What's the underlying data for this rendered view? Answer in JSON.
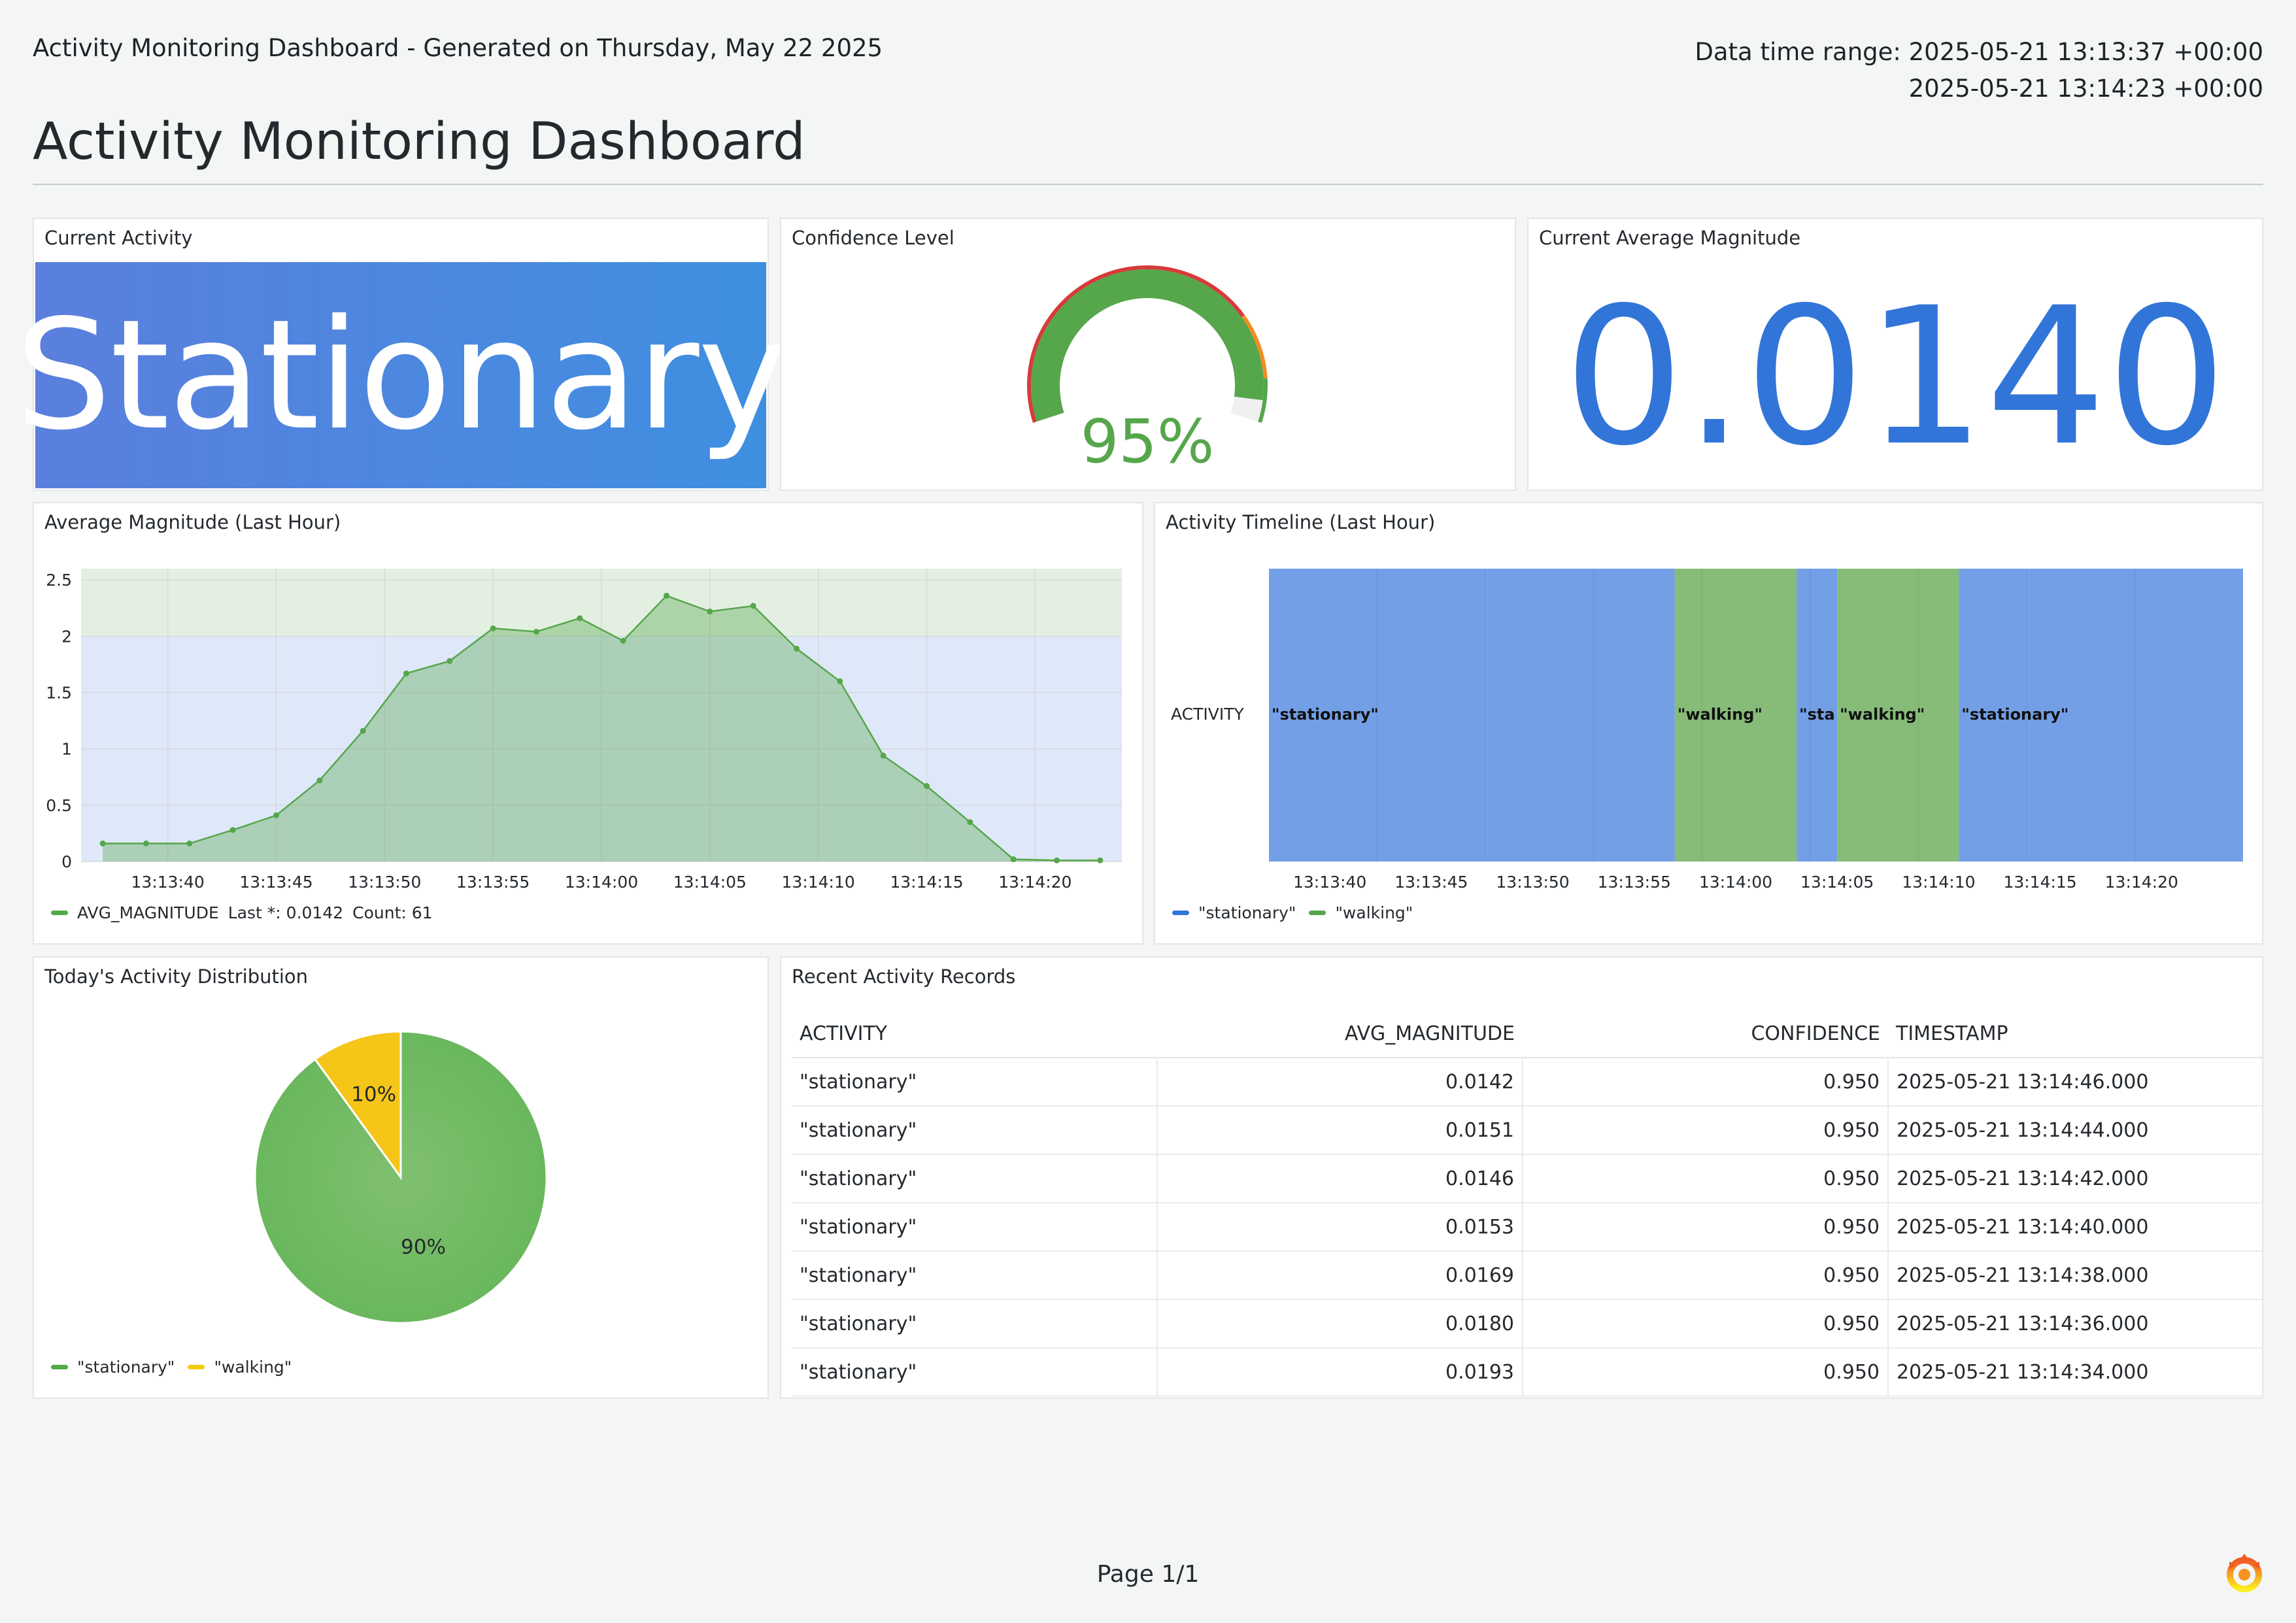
{
  "header": {
    "generated": "Activity Monitoring Dashboard - Generated on Thursday, May 22 2025",
    "time_range_line1": "Data time range: 2025-05-21 13:13:37 +00:00",
    "time_range_line2": "2025-05-21 13:14:23 +00:00",
    "title": "Activity Monitoring Dashboard"
  },
  "panels": {
    "current_activity": {
      "title": "Current Activity",
      "value": "Stationary"
    },
    "confidence": {
      "title": "Confidence Level",
      "value": "95%",
      "percent": 95
    },
    "magnitude": {
      "title": "Current Average Magnitude",
      "value": "0.0140"
    },
    "avg_chart": {
      "title": "Average Magnitude (Last Hour)",
      "legend_series": "AVG_MAGNITUDE",
      "legend_last": "Last *: 0.0142",
      "legend_count": "Count: 61"
    },
    "timeline": {
      "title": "Activity Timeline (Last Hour)",
      "row_label": "ACTIVITY",
      "legend": [
        "\"stationary\"",
        "\"walking\""
      ]
    },
    "distribution": {
      "title": "Today's Activity Distribution",
      "legend": [
        "\"stationary\"",
        "\"walking\""
      ]
    },
    "records": {
      "title": "Recent Activity Records",
      "columns": [
        "ACTIVITY",
        "AVG_MAGNITUDE",
        "CONFIDENCE",
        "TIMESTAMP"
      ],
      "rows": [
        [
          "\"stationary\"",
          "0.0142",
          "0.950",
          "2025-05-21 13:14:46.000"
        ],
        [
          "\"stationary\"",
          "0.0151",
          "0.950",
          "2025-05-21 13:14:44.000"
        ],
        [
          "\"stationary\"",
          "0.0146",
          "0.950",
          "2025-05-21 13:14:42.000"
        ],
        [
          "\"stationary\"",
          "0.0153",
          "0.950",
          "2025-05-21 13:14:40.000"
        ],
        [
          "\"stationary\"",
          "0.0169",
          "0.950",
          "2025-05-21 13:14:38.000"
        ],
        [
          "\"stationary\"",
          "0.0180",
          "0.950",
          "2025-05-21 13:14:36.000"
        ],
        [
          "\"stationary\"",
          "0.0193",
          "0.950",
          "2025-05-21 13:14:34.000"
        ]
      ]
    }
  },
  "colors": {
    "green": "#56a64b",
    "blue": "#3275d9",
    "timeline_blue": "#739fe6",
    "timeline_green": "#86bb78",
    "yellow": "#f2cc0c",
    "gauge_red": "#d83a3a",
    "gauge_orange": "#f28c1f"
  },
  "chart_data": [
    {
      "type": "area",
      "title": "",
      "x": [
        "13:13:37",
        "13:13:39",
        "13:13:41",
        "13:13:43",
        "13:13:45",
        "13:13:47",
        "13:13:49",
        "13:13:51",
        "13:13:53",
        "13:13:55",
        "13:13:57",
        "13:13:59",
        "13:14:01",
        "13:14:03",
        "13:14:05",
        "13:14:07",
        "13:14:09",
        "13:14:11",
        "13:14:13",
        "13:14:15",
        "13:14:17",
        "13:14:19",
        "13:14:21",
        "13:14:23"
      ],
      "x_ticks": [
        "13:13:40",
        "13:13:45",
        "13:13:50",
        "13:13:55",
        "13:14:00",
        "13:14:05",
        "13:14:10",
        "13:14:15",
        "13:14:20"
      ],
      "series": [
        {
          "name": "AVG_MAGNITUDE",
          "values": [
            0.16,
            0.16,
            0.16,
            0.28,
            0.41,
            0.72,
            1.16,
            1.67,
            1.78,
            2.07,
            2.04,
            2.16,
            1.96,
            2.36,
            2.22,
            2.27,
            1.89,
            1.6,
            0.94,
            0.67,
            0.35,
            0.02,
            0.01,
            0.01
          ]
        }
      ],
      "y_ticks": [
        "0",
        "0.5",
        "1",
        "1.5",
        "2",
        "2.5"
      ],
      "ylim": [
        0,
        2.6
      ],
      "thresholds": [
        {
          "from": 0,
          "to": 2,
          "color": "#dfe8f8"
        },
        {
          "from": 2,
          "to": 2.6,
          "color": "#e3f0e1"
        }
      ],
      "grid": true
    },
    {
      "type": "state-timeline",
      "x_ticks": [
        "13:13:40",
        "13:13:45",
        "13:13:50",
        "13:13:55",
        "13:14:00",
        "13:14:05",
        "13:14:10",
        "13:14:15",
        "13:14:20"
      ],
      "segments": [
        {
          "state": "\"stationary\"",
          "label": "\"stationary\"",
          "start": "13:13:37",
          "end": "13:13:57"
        },
        {
          "state": "\"walking\"",
          "label": "\"walking\"",
          "start": "13:13:57",
          "end": "13:14:03"
        },
        {
          "state": "\"stationary\"",
          "label": "\"sta",
          "start": "13:14:03",
          "end": "13:14:05"
        },
        {
          "state": "\"walking\"",
          "label": "\"walking\"",
          "start": "13:14:05",
          "end": "13:14:11"
        },
        {
          "state": "\"stationary\"",
          "label": "\"stationary\"",
          "start": "13:14:11",
          "end": "13:14:25"
        }
      ]
    },
    {
      "type": "pie",
      "slices": [
        {
          "name": "\"stationary\"",
          "value": 90,
          "label": "90%",
          "color": "#6fb862"
        },
        {
          "name": "\"walking\"",
          "value": 10,
          "label": "10%",
          "color": "#f5c518"
        }
      ]
    }
  ]
}
